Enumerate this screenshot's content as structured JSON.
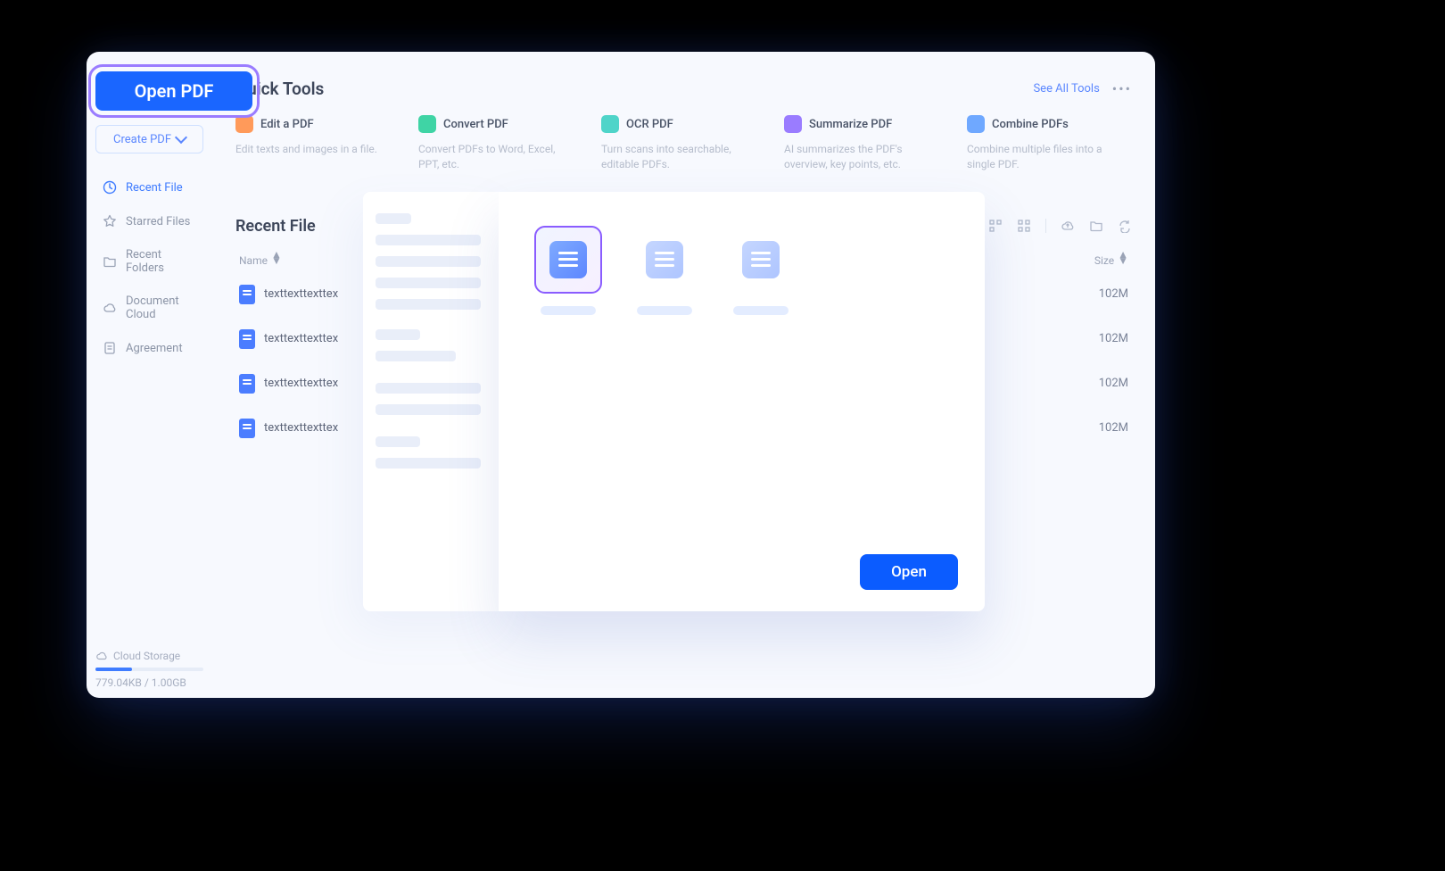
{
  "sidebar": {
    "open_pdf": "Open PDF",
    "create_pdf": "Create PDF",
    "nav": [
      {
        "label": "Recent File",
        "icon": "clock-icon",
        "active": true
      },
      {
        "label": "Starred Files",
        "icon": "star-icon"
      },
      {
        "label": "Recent Folders",
        "icon": "folder-icon"
      },
      {
        "label": "Document Cloud",
        "icon": "cloud-icon"
      },
      {
        "label": "Agreement",
        "icon": "agreement-icon"
      }
    ],
    "cloud_label": "Cloud Storage",
    "cloud_usage": "779.04KB / 1.00GB"
  },
  "quick_tools": {
    "title": "Quick Tools",
    "see_all": "See All Tools",
    "items": [
      {
        "title": "Edit a PDF",
        "desc": "Edit texts and images in a file.",
        "icon": "edit-icon",
        "color": "#ff9a5a"
      },
      {
        "title": "Convert PDF",
        "desc": "Convert PDFs to Word, Excel, PPT, etc.",
        "icon": "convert-icon",
        "color": "#3fd4a5"
      },
      {
        "title": "OCR PDF",
        "desc": "Turn scans into searchable, editable PDFs.",
        "icon": "ocr-icon",
        "color": "#4fd4c9"
      },
      {
        "title": "Summarize PDF",
        "desc": "AI summarizes the PDF's overview, key points, etc.",
        "icon": "summarize-icon",
        "color": "#9a7cff"
      },
      {
        "title": "Combine PDFs",
        "desc": "Combine multiple files into a single PDF.",
        "icon": "combine-icon",
        "color": "#6fa8ff"
      }
    ]
  },
  "recent": {
    "title": "Recent File",
    "col_name": "Name",
    "col_size": "Size",
    "files": [
      {
        "name": "texttexttexttex",
        "size": "102M"
      },
      {
        "name": "texttexttexttex",
        "size": "102M"
      },
      {
        "name": "texttexttexttex",
        "size": "102M"
      },
      {
        "name": "texttexttexttex",
        "size": "102M"
      }
    ]
  },
  "dialog": {
    "open_label": "Open"
  }
}
